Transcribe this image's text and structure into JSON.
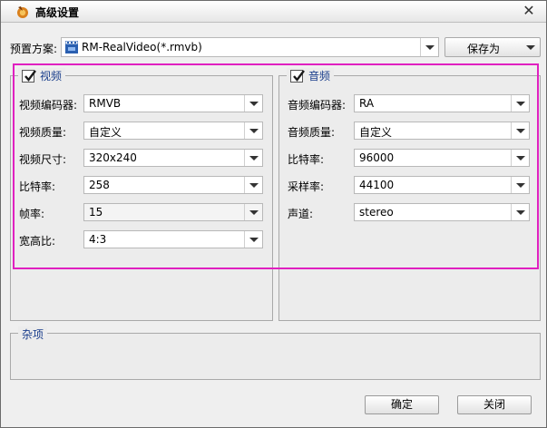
{
  "window": {
    "title": "高级设置"
  },
  "preset": {
    "label": "预置方案:",
    "value": "RM-RealVideo(*.rmvb)",
    "save_as_label": "保存为"
  },
  "video": {
    "legend": "视频",
    "checked": true,
    "fields": [
      {
        "label": "视频编码器:",
        "value": "RMVB"
      },
      {
        "label": "视频质量:",
        "value": "自定义"
      },
      {
        "label": "视频尺寸:",
        "value": "320x240"
      },
      {
        "label": "比特率:",
        "value": "258"
      },
      {
        "label": "帧率:",
        "value": "15"
      },
      {
        "label": "宽高比:",
        "value": "4:3"
      }
    ]
  },
  "audio": {
    "legend": "音频",
    "checked": true,
    "fields": [
      {
        "label": "音频编码器:",
        "value": "RA"
      },
      {
        "label": "音频质量:",
        "value": "自定义"
      },
      {
        "label": "比特率:",
        "value": "96000"
      },
      {
        "label": "采样率:",
        "value": "44100"
      },
      {
        "label": "声道:",
        "value": "stereo"
      }
    ]
  },
  "misc": {
    "legend": "杂项"
  },
  "buttons": {
    "ok": "确定",
    "close": "关闭"
  },
  "colors": {
    "highlight_frame": "#e020c0",
    "legend_text": "#1a3e8c"
  }
}
